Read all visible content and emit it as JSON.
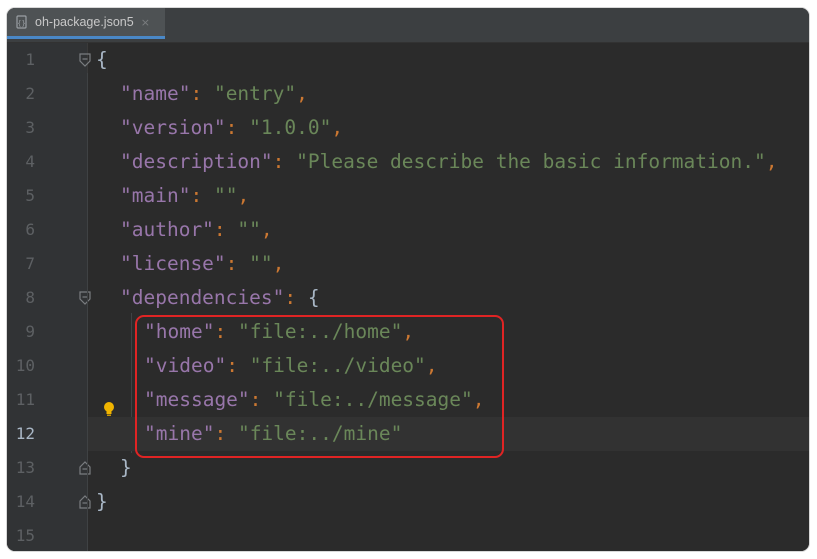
{
  "tab": {
    "label": "oh-package.json5",
    "close_glyph": "×",
    "icon": "json5-file-icon"
  },
  "gutter": {
    "line_numbers": [
      "1",
      "2",
      "3",
      "4",
      "5",
      "6",
      "7",
      "8",
      "9",
      "10",
      "11",
      "12",
      "13",
      "14",
      "15"
    ],
    "active_line": "12"
  },
  "code": {
    "l1": {
      "brace": "{"
    },
    "l2": {
      "key": "\"name\"",
      "colon": ":",
      "value": "\"entry\"",
      "comma": ","
    },
    "l3": {
      "key": "\"version\"",
      "colon": ":",
      "value": "\"1.0.0\"",
      "comma": ","
    },
    "l4": {
      "key": "\"description\"",
      "colon": ":",
      "value": "\"Please describe the basic information.\"",
      "comma": ","
    },
    "l5": {
      "key": "\"main\"",
      "colon": ":",
      "value": "\"\"",
      "comma": ","
    },
    "l6": {
      "key": "\"author\"",
      "colon": ":",
      "value": "\"\"",
      "comma": ","
    },
    "l7": {
      "key": "\"license\"",
      "colon": ":",
      "value": "\"\"",
      "comma": ","
    },
    "l8": {
      "key": "\"dependencies\"",
      "colon": ":",
      "brace": "{"
    },
    "l9": {
      "key": "\"home\"",
      "colon": ":",
      "value": "\"file:../home\"",
      "comma": ","
    },
    "l10": {
      "key": "\"video\"",
      "colon": ":",
      "value": "\"file:../video\"",
      "comma": ","
    },
    "l11": {
      "key": "\"message\"",
      "colon": ":",
      "value": "\"file:../message\"",
      "comma": ","
    },
    "l12": {
      "key": "\"mine\"",
      "colon": ":",
      "value": "\"file:../mine\""
    },
    "l13": {
      "brace": "}"
    },
    "l14": {
      "brace": "}"
    }
  },
  "colors": {
    "background": "#2b2b2b",
    "key": "#9876aa",
    "string": "#6a8759",
    "punctuation": "#cc7832",
    "highlight_box": "#e02424",
    "tab_underline": "#4a88c7"
  },
  "annotations": {
    "highlight": "dependencies entries highlighted with red box",
    "intention_icon": "lightbulb-icon"
  }
}
